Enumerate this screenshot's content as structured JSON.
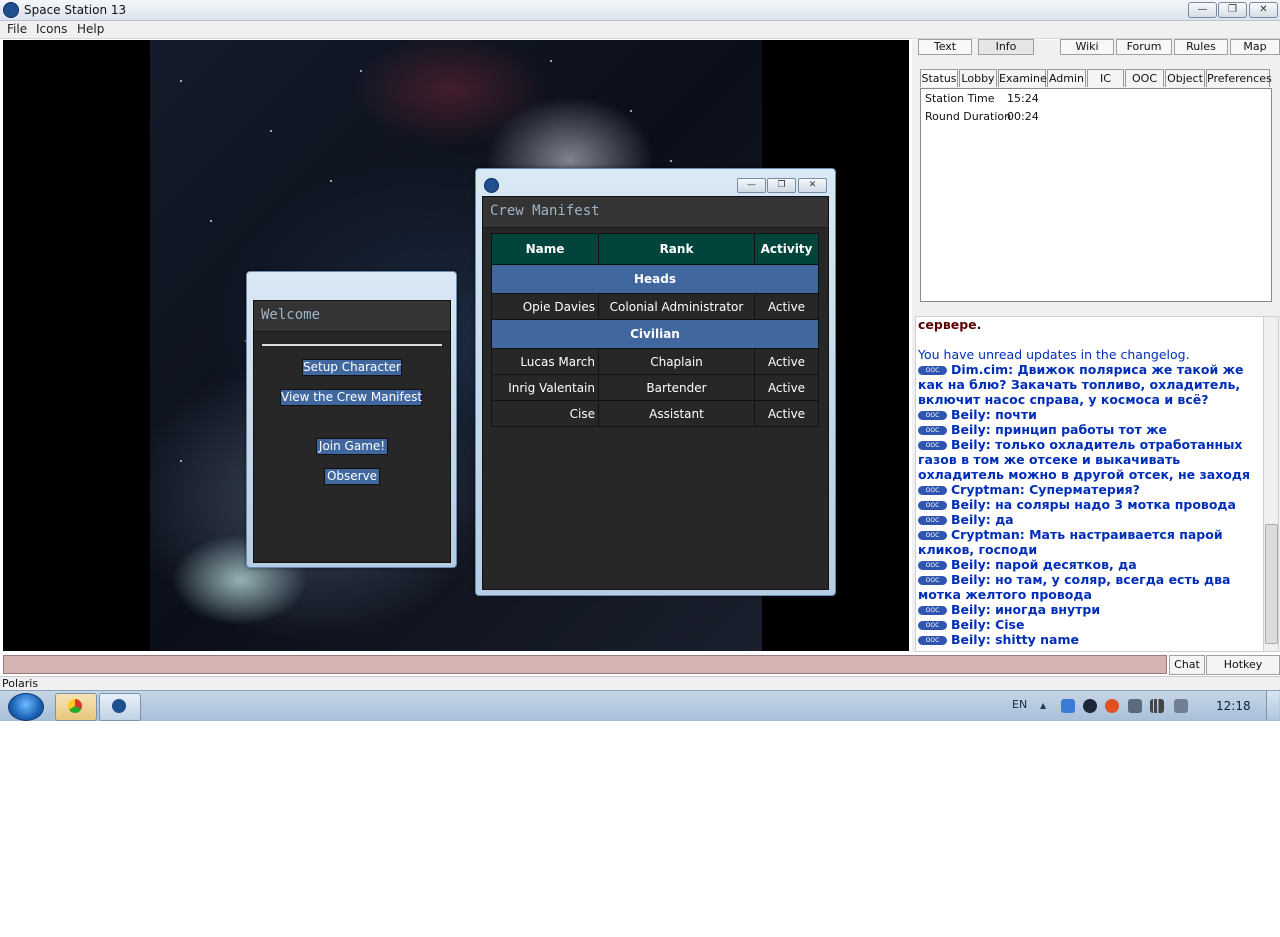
{
  "window": {
    "title": "Space Station 13",
    "minimize": "—",
    "maximize": "❐",
    "close": "✕"
  },
  "menu": [
    "File",
    "Icons",
    "Help"
  ],
  "welcome": {
    "title": "Welcome",
    "buttons": {
      "setup": "Setup Character",
      "manifest": "View the Crew Manifest",
      "join": "Join Game!",
      "observe": "Observe"
    }
  },
  "manifest": {
    "title": "Crew Manifest",
    "columns": [
      "Name",
      "Rank",
      "Activity"
    ],
    "sections": [
      {
        "label": "Heads",
        "rows": [
          [
            "Opie Davies",
            "Colonial Administrator",
            "Active"
          ]
        ]
      },
      {
        "label": "Civilian",
        "rows": [
          [
            "Lucas March",
            "Chaplain",
            "Active"
          ],
          [
            "Inrig Valentain",
            "Bartender",
            "Active"
          ],
          [
            "Cise",
            "Assistant",
            "Active"
          ]
        ]
      }
    ]
  },
  "top_buttons": [
    "Text",
    "Info",
    "Wiki",
    "Forum",
    "Rules",
    "Map"
  ],
  "tabs": [
    "Status",
    "Lobby",
    "Examine",
    "Admin",
    "IC",
    "OOC",
    "Object",
    "Preferences"
  ],
  "status": {
    "station_time_label": "Station Time",
    "station_time": "15:24",
    "round_duration_label": "Round Duration",
    "round_duration": "00:24"
  },
  "chat": {
    "ooc_tag": "OOC",
    "server_line": "сервере.",
    "changelog_line": "You have unread updates in the changelog.",
    "messages": [
      "Dim.cim: Движок поляриса же такой же как на блю? Закачать топливо, охладитель, включит насос справа, у космоса и всё?",
      "Beily: почти",
      "Beily: принцип работы тот же",
      "Beily: только охладитель отработанных газов в том же отсеке и выкачивать охладитель можно в другой отсек, не заходя",
      "Cryptman: Суперматерия?",
      "Beily: на соляры надо 3 мотка провода",
      "Beily: да",
      "Cryptman: Мать настраивается парой кликов, господи",
      "Beily: парой десятков, да",
      "Beily: но там, у соляр, всегда есть два мотка желтого провода",
      "Beily: иногда внутри",
      "Beily: Cise",
      "Beily: shitty name"
    ]
  },
  "input_bar": {
    "chat_button": "Chat",
    "hotkey_button": "Hotkey Toggle"
  },
  "statusbar": {
    "text": "Polaris"
  },
  "taskbar": {
    "language": "EN",
    "clock": "12:18",
    "tray_arrow": "▲"
  },
  "colors": {
    "accent_button": "#40679e",
    "manifest_header": "#00443c",
    "ooc_text": "#002eb8",
    "input_bar": "#d6b3b3"
  }
}
